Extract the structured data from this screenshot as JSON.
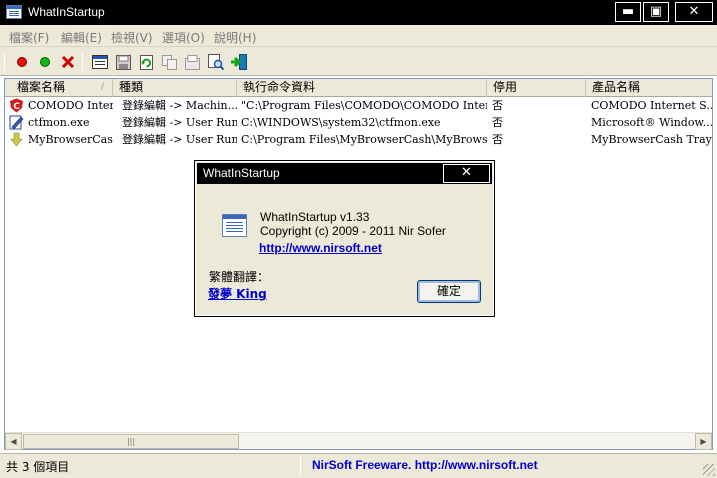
{
  "window": {
    "title": "WhatInStartup",
    "minimize_glyph": "▬",
    "maximize_glyph": "▣",
    "close_glyph": "✕"
  },
  "menu": [
    {
      "label": "檔案(F)"
    },
    {
      "label": "編輯(E)"
    },
    {
      "label": "檢視(V)"
    },
    {
      "label": "選項(O)"
    },
    {
      "label": "說明(H)"
    }
  ],
  "toolbar": {
    "icons": [
      "disable-red-dot-icon",
      "enable-green-dot-icon",
      "delete-x-icon",
      "properties-icon",
      "save-icon",
      "refresh-icon",
      "copy-icon",
      "html-report-icon",
      "find-icon",
      "exit-icon"
    ],
    "colors": {
      "red": "#e01010",
      "green": "#12b312",
      "delete": "#cc0000"
    }
  },
  "list": {
    "columns": [
      "檔案名稱",
      "種類",
      "執行命令資料",
      "停用",
      "產品名稱"
    ],
    "sort_arrow": "/",
    "rows": [
      {
        "icon": "comodo-icon",
        "name": "COMODO Inter...",
        "type": "登錄編輯 -> Machin...",
        "command": "\"C:\\Program Files\\COMODO\\COMODO Internet...",
        "disabled": "否",
        "product": "COMODO Internet S..."
      },
      {
        "icon": "ctfmon-icon",
        "name": "ctfmon.exe",
        "type": "登錄編輯 -> User Run",
        "command": "C:\\WINDOWS\\system32\\ctfmon.exe",
        "disabled": "否",
        "product": "Microsoft® Window..."
      },
      {
        "icon": "browsercash-icon",
        "name": "MyBrowserCash",
        "type": "登錄編輯 -> User Run",
        "command": "C:\\Program Files\\MyBrowserCash\\MyBrowserC...",
        "disabled": "否",
        "product": "MyBrowserCash Tray"
      }
    ],
    "scroll_left_glyph": "◀",
    "scroll_right_glyph": "▶",
    "scroll_thumb_glyph": "|||"
  },
  "status": {
    "count": "共 3 個項目",
    "link": "NirSoft Freeware.  http://www.nirsoft.net"
  },
  "dialog": {
    "title": "WhatInStartup",
    "close_glyph": "✕",
    "app_version": "WhatInStartup v1.33",
    "copyright": "Copyright (c) 2009 - 2011 Nir Sofer",
    "url": "http://www.nirsoft.net",
    "translation_label": "繁體翻譯：",
    "translator": "發夢 King",
    "ok_label": "確定"
  }
}
